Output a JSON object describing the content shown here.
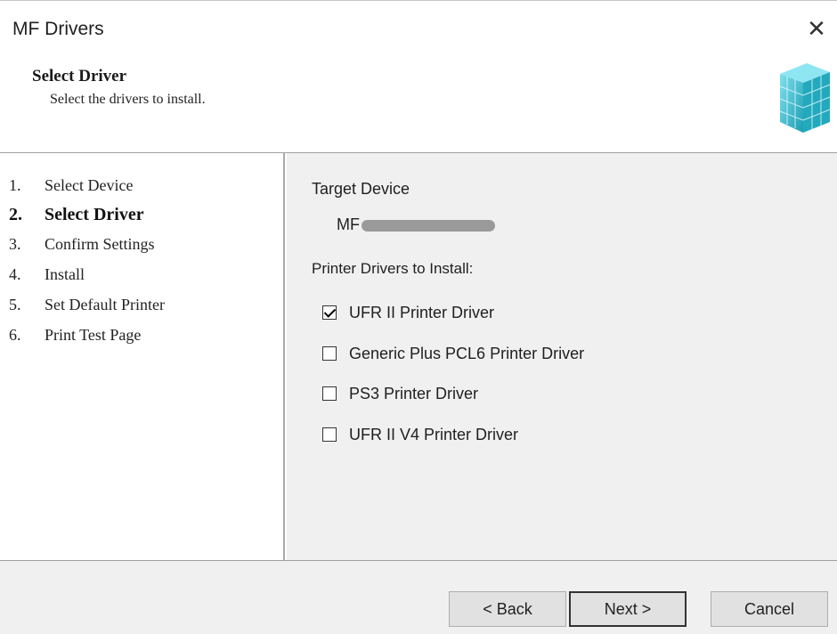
{
  "window": {
    "title": "MF Drivers",
    "close_glyph": "✕"
  },
  "header": {
    "title": "Select Driver",
    "subtitle": "Select the drivers to install.",
    "icon": "cube-icon"
  },
  "steps": [
    {
      "num": "1.",
      "label": "Select Device",
      "current": false
    },
    {
      "num": "2.",
      "label": "Select Driver",
      "current": true
    },
    {
      "num": "3.",
      "label": "Confirm Settings",
      "current": false
    },
    {
      "num": "4.",
      "label": "Install",
      "current": false
    },
    {
      "num": "5.",
      "label": "Set Default Printer",
      "current": false
    },
    {
      "num": "6.",
      "label": "Print Test Page",
      "current": false
    }
  ],
  "content": {
    "target_label": "Target Device",
    "device_prefix": "MF",
    "drivers_label": "Printer Drivers to Install:",
    "drivers": [
      {
        "label": "UFR II Printer Driver",
        "checked": true
      },
      {
        "label": "Generic Plus PCL6 Printer Driver",
        "checked": false
      },
      {
        "label": "PS3 Printer Driver",
        "checked": false
      },
      {
        "label": "UFR II V4 Printer Driver",
        "checked": false
      }
    ]
  },
  "footer": {
    "back_label": "< Back",
    "next_label": "Next >",
    "cancel_label": "Cancel"
  },
  "colors": {
    "panel_bg": "#f0f0f0",
    "icon_teal": "#2fb8c8"
  }
}
